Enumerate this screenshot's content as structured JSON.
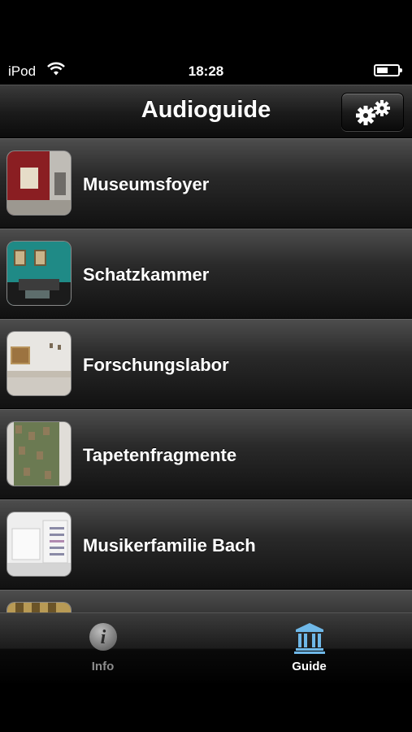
{
  "status_bar": {
    "carrier": "iPod",
    "time": "18:28",
    "battery_level": 0.55,
    "wifi_icon": "wifi-icon",
    "battery_icon": "battery-icon"
  },
  "nav": {
    "title": "Audioguide",
    "settings_icon": "gears-icon"
  },
  "rooms": [
    {
      "label": "Museumsfoyer"
    },
    {
      "label": "Schatzkammer"
    },
    {
      "label": "Forschungslabor"
    },
    {
      "label": "Tapetenfragmente"
    },
    {
      "label": "Musikerfamilie Bach"
    }
  ],
  "tabs": [
    {
      "label": "Info",
      "icon": "info-icon",
      "selected": false
    },
    {
      "label": "Guide",
      "icon": "museum-icon",
      "selected": true
    }
  ],
  "colors": {
    "tab_active": "#6fb8e8",
    "tab_inactive": "#8c8c8c"
  }
}
